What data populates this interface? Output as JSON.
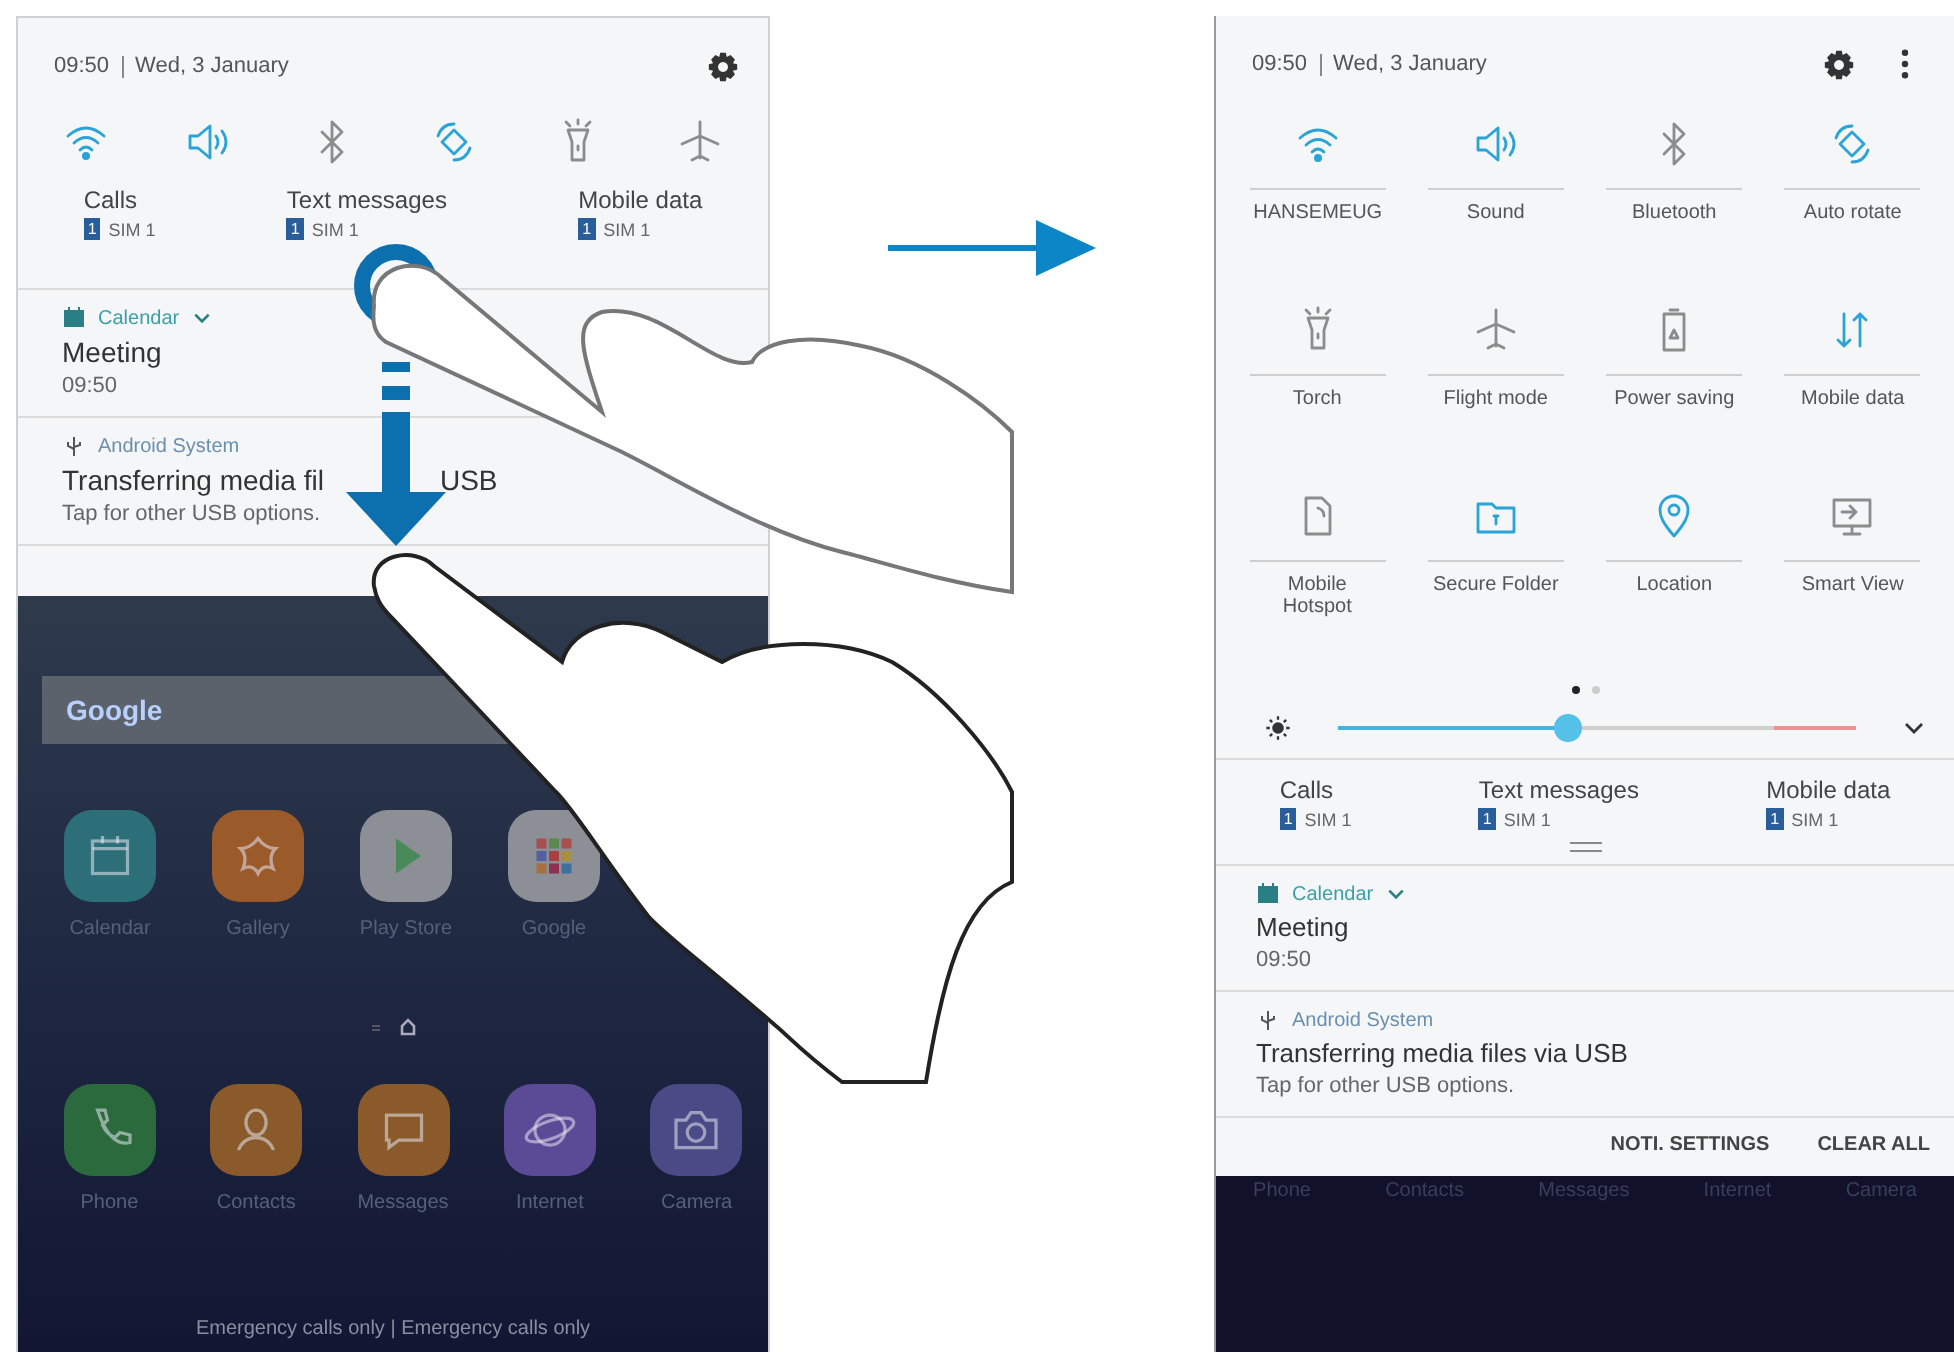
{
  "left_screen": {
    "status": {
      "time": "09:50",
      "date": "Wed, 3 January"
    },
    "quick_toggles": [
      {
        "kind": "wifi",
        "on": true
      },
      {
        "kind": "sound",
        "on": true
      },
      {
        "kind": "bluetooth",
        "on": false
      },
      {
        "kind": "rotate",
        "on": true
      },
      {
        "kind": "torch",
        "on": false
      },
      {
        "kind": "flight",
        "on": false
      }
    ],
    "sim_settings": [
      {
        "label": "Calls",
        "badge": "1",
        "sim": "SIM 1"
      },
      {
        "label": "Text messages",
        "badge": "1",
        "sim": "SIM 1"
      },
      {
        "label": "Mobile data",
        "badge": "1",
        "sim": "SIM 1"
      }
    ],
    "notifications": [
      {
        "kind": "calendar",
        "app": "Calendar",
        "title_parts": [
          "Meeting"
        ],
        "text": "09:50"
      },
      {
        "kind": "usb",
        "app": "Android System",
        "title_parts": [
          "Transferring media fil",
          "USB"
        ],
        "text": "Tap for other USB options."
      }
    ],
    "home_screen": {
      "search_logo": "Google",
      "apps": [
        {
          "label": "Calendar",
          "kind": "calendar",
          "color": "#2c6f78"
        },
        {
          "label": "Gallery",
          "kind": "gallery",
          "color": "#9a5a2a"
        },
        {
          "label": "Play Store",
          "kind": "play",
          "color": "#8c8f96"
        },
        {
          "label": "Google",
          "kind": "folder",
          "color": "#8c8f96"
        }
      ],
      "dock": [
        {
          "label": "Phone",
          "kind": "phone",
          "color": "#2a6a3c"
        },
        {
          "label": "Contacts",
          "kind": "contacts",
          "color": "#8a5a2a"
        },
        {
          "label": "Messages",
          "kind": "messages",
          "color": "#8a5a2a"
        },
        {
          "label": "Internet",
          "kind": "internet",
          "color": "#5b4a96"
        },
        {
          "label": "Camera",
          "kind": "camera",
          "color": "#4a4a86"
        }
      ],
      "status_text": "Emergency calls only | Emergency calls only"
    }
  },
  "right_screen": {
    "status": {
      "time": "09:50",
      "date": "Wed, 3 January"
    },
    "quick_settings": [
      {
        "kind": "wifi",
        "label": "HANSEMEUG",
        "on": true
      },
      {
        "kind": "sound",
        "label": "Sound",
        "on": true
      },
      {
        "kind": "bluetooth",
        "label": "Bluetooth",
        "on": false
      },
      {
        "kind": "rotate",
        "label": "Auto rotate",
        "on": true
      },
      {
        "kind": "torch",
        "label": "Torch",
        "on": false
      },
      {
        "kind": "flight",
        "label": "Flight mode",
        "on": false
      },
      {
        "kind": "power",
        "label": "Power saving",
        "on": false
      },
      {
        "kind": "data",
        "label": "Mobile data",
        "on": true
      },
      {
        "kind": "hotspot",
        "label": "Mobile Hotspot",
        "on": false
      },
      {
        "kind": "secure",
        "label": "Secure Folder",
        "on": true
      },
      {
        "kind": "location",
        "label": "Location",
        "on": true
      },
      {
        "kind": "smartview",
        "label": "Smart View",
        "on": false
      }
    ],
    "pages": [
      {
        "selected": true
      },
      {
        "selected": false
      }
    ],
    "brightness": {
      "level": 0.42
    },
    "sim_settings": [
      {
        "label": "Calls",
        "badge": "1",
        "sim": "SIM 1"
      },
      {
        "label": "Text messages",
        "badge": "1",
        "sim": "SIM 1"
      },
      {
        "label": "Mobile data",
        "badge": "1",
        "sim": "SIM 1"
      }
    ],
    "notifications": [
      {
        "kind": "calendar",
        "app": "Calendar",
        "title": "Meeting",
        "text": "09:50"
      },
      {
        "kind": "usb",
        "app": "Android System",
        "title": "Transferring media files via USB",
        "text": "Tap for other USB options."
      }
    ],
    "actions": [
      "NOTI. SETTINGS",
      "CLEAR ALL"
    ],
    "dock_labels": [
      "Phone",
      "Contacts",
      "Messages",
      "Internet",
      "Camera"
    ]
  }
}
